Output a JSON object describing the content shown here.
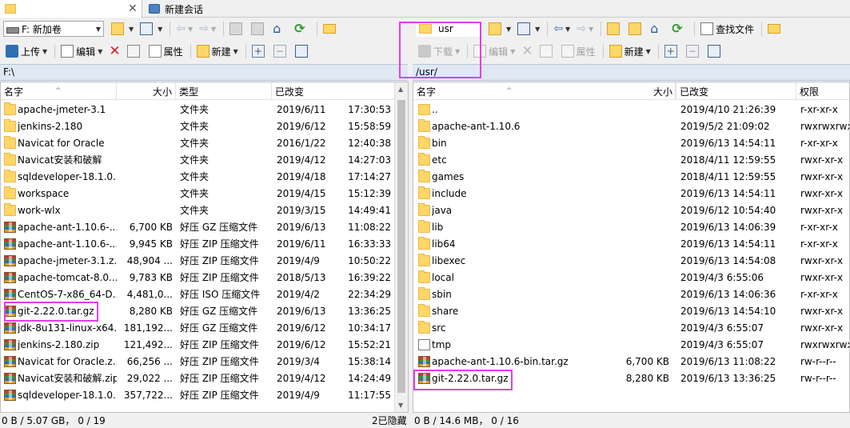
{
  "tabs": [
    {
      "label": "",
      "icon": "folder-tab-icon"
    },
    {
      "label": "新建会话",
      "icon": "new-session-icon"
    }
  ],
  "left": {
    "drive_label": "F: 新加卷",
    "toolbar": {
      "upload": "上传",
      "edit": "编辑",
      "properties": "属性",
      "new": "新建"
    },
    "path": "F:\\",
    "columns": {
      "name": "名字",
      "size": "大小",
      "type": "类型",
      "modified": "已改变"
    },
    "files": [
      {
        "name": "apache-jmeter-3.1",
        "size": "",
        "type": "文件夹",
        "date": "2019/6/11",
        "time": "17:30:53",
        "icon": "folder"
      },
      {
        "name": "jenkins-2.180",
        "size": "",
        "type": "文件夹",
        "date": "2019/6/12",
        "time": "15:58:59",
        "icon": "folder"
      },
      {
        "name": "Navicat for Oracle",
        "size": "",
        "type": "文件夹",
        "date": "2016/1/22",
        "time": "12:40:38",
        "icon": "folder"
      },
      {
        "name": "Navicat安装和破解",
        "size": "",
        "type": "文件夹",
        "date": "2019/4/12",
        "time": "14:27:03",
        "icon": "folder"
      },
      {
        "name": "sqldeveloper-18.1.0...",
        "size": "",
        "type": "文件夹",
        "date": "2019/4/18",
        "time": "17:14:27",
        "icon": "folder"
      },
      {
        "name": "workspace",
        "size": "",
        "type": "文件夹",
        "date": "2019/4/15",
        "time": "15:12:39",
        "icon": "folder"
      },
      {
        "name": "work-wlx",
        "size": "",
        "type": "文件夹",
        "date": "2019/3/15",
        "time": "14:49:41",
        "icon": "folder"
      },
      {
        "name": "apache-ant-1.10.6-...",
        "size": "6,700 KB",
        "type": "好压 GZ 压缩文件",
        "date": "2019/6/13",
        "time": "11:08:22",
        "icon": "archive"
      },
      {
        "name": "apache-ant-1.10.6-...",
        "size": "9,945 KB",
        "type": "好压 ZIP 压缩文件",
        "date": "2019/6/11",
        "time": "16:33:33",
        "icon": "archive"
      },
      {
        "name": "apache-jmeter-3.1.z...",
        "size": "48,904 ...",
        "type": "好压 ZIP 压缩文件",
        "date": "2019/4/9",
        "time": "10:50:22",
        "icon": "archive"
      },
      {
        "name": "apache-tomcat-8.0....",
        "size": "9,783 KB",
        "type": "好压 ZIP 压缩文件",
        "date": "2018/5/13",
        "time": "16:39:22",
        "icon": "archive"
      },
      {
        "name": "CentOS-7-x86_64-D...",
        "size": "4,481,0...",
        "type": "好压 ISO 压缩文件",
        "date": "2019/4/2",
        "time": "22:34:29",
        "icon": "archive"
      },
      {
        "name": "git-2.22.0.tar.gz",
        "size": "8,280 KB",
        "type": "好压 GZ 压缩文件",
        "date": "2019/6/13",
        "time": "13:36:25",
        "icon": "archive"
      },
      {
        "name": "jdk-8u131-linux-x64...",
        "size": "181,192...",
        "type": "好压 GZ 压缩文件",
        "date": "2019/6/12",
        "time": "10:34:17",
        "icon": "archive"
      },
      {
        "name": "jenkins-2.180.zip",
        "size": "121,492...",
        "type": "好压 ZIP 压缩文件",
        "date": "2019/6/12",
        "time": "15:52:21",
        "icon": "archive"
      },
      {
        "name": "Navicat for Oracle.z...",
        "size": "66,256 ...",
        "type": "好压 ZIP 压缩文件",
        "date": "2019/3/4",
        "time": "15:38:14",
        "icon": "archive"
      },
      {
        "name": "Navicat安装和破解.zip",
        "size": "29,022 ...",
        "type": "好压 ZIP 压缩文件",
        "date": "2019/4/12",
        "time": "14:24:49",
        "icon": "archive"
      },
      {
        "name": "sqldeveloper-18.1.0...",
        "size": "357,722...",
        "type": "好压 ZIP 压缩文件",
        "date": "2019/4/9",
        "time": "11:17:55",
        "icon": "archive"
      }
    ],
    "status": "0 B / 5.07 GB，  0 / 19",
    "hidden": "2已隐藏"
  },
  "right": {
    "path_combo": "usr",
    "toolbar": {
      "download": "下载",
      "edit": "编辑",
      "properties": "属性",
      "new": "新建"
    },
    "path": "/usr/",
    "columns": {
      "name": "名字",
      "size": "大小",
      "modified": "已改变",
      "perms": "权限"
    },
    "files": [
      {
        "name": "..",
        "size": "",
        "modified": "2019/4/10 21:26:39",
        "perms": "r-xr-xr-x",
        "icon": "up"
      },
      {
        "name": "apache-ant-1.10.6",
        "size": "",
        "modified": "2019/5/2 21:09:02",
        "perms": "rwxrwxrwx",
        "icon": "folder"
      },
      {
        "name": "bin",
        "size": "",
        "modified": "2019/6/13 14:54:11",
        "perms": "r-xr-xr-x",
        "icon": "folder"
      },
      {
        "name": "etc",
        "size": "",
        "modified": "2018/4/11 12:59:55",
        "perms": "rwxr-xr-x",
        "icon": "folder"
      },
      {
        "name": "games",
        "size": "",
        "modified": "2018/4/11 12:59:55",
        "perms": "rwxr-xr-x",
        "icon": "folder"
      },
      {
        "name": "include",
        "size": "",
        "modified": "2019/6/13 14:54:11",
        "perms": "rwxr-xr-x",
        "icon": "folder"
      },
      {
        "name": "java",
        "size": "",
        "modified": "2019/6/12 10:54:40",
        "perms": "rwxr-xr-x",
        "icon": "folder"
      },
      {
        "name": "lib",
        "size": "",
        "modified": "2019/6/13 14:06:39",
        "perms": "r-xr-xr-x",
        "icon": "folder"
      },
      {
        "name": "lib64",
        "size": "",
        "modified": "2019/6/13 14:54:11",
        "perms": "r-xr-xr-x",
        "icon": "folder"
      },
      {
        "name": "libexec",
        "size": "",
        "modified": "2019/6/13 14:54:08",
        "perms": "rwxr-xr-x",
        "icon": "folder"
      },
      {
        "name": "local",
        "size": "",
        "modified": "2019/4/3 6:55:06",
        "perms": "rwxr-xr-x",
        "icon": "folder"
      },
      {
        "name": "sbin",
        "size": "",
        "modified": "2019/6/13 14:06:36",
        "perms": "r-xr-xr-x",
        "icon": "folder"
      },
      {
        "name": "share",
        "size": "",
        "modified": "2019/6/13 14:54:10",
        "perms": "rwxr-xr-x",
        "icon": "folder"
      },
      {
        "name": "src",
        "size": "",
        "modified": "2019/4/3 6:55:07",
        "perms": "rwxr-xr-x",
        "icon": "folder"
      },
      {
        "name": "tmp",
        "size": "",
        "modified": "2019/4/3 6:55:07",
        "perms": "rwxrwxrwx",
        "icon": "link"
      },
      {
        "name": "apache-ant-1.10.6-bin.tar.gz",
        "size": "6,700 KB",
        "modified": "2019/6/13 11:08:22",
        "perms": "rw-r--r--",
        "icon": "archive"
      },
      {
        "name": "git-2.22.0.tar.gz",
        "size": "8,280 KB",
        "modified": "2019/6/13 13:36:25",
        "perms": "rw-r--r--",
        "icon": "archive"
      }
    ],
    "status": "0 B / 14.6 MB，  0 / 16"
  },
  "misc": {
    "find_files": "查找文件"
  },
  "colors": {
    "highlight": "#e63ce6",
    "pathbar": "#dfe8f3"
  }
}
